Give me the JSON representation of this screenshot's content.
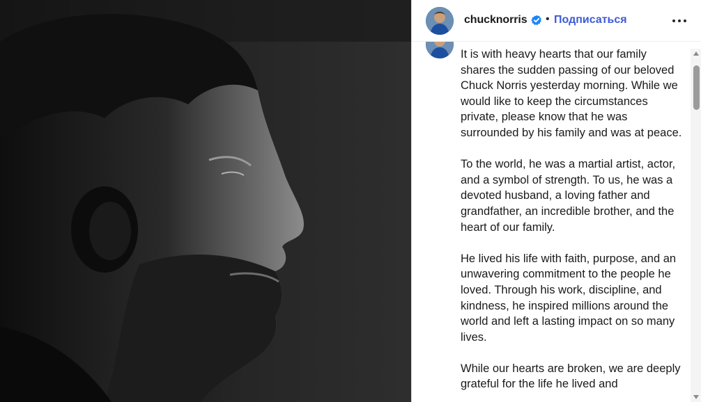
{
  "post": {
    "photo_description_icon": "profile-portrait-photo"
  },
  "header": {
    "username": "chucknorris",
    "separator": "•",
    "follow_label": "Подписаться",
    "verified_color": "#1b86f5",
    "accent_color": "#3d5bd6"
  },
  "caption": {
    "paragraphs": [
      "It is with heavy hearts that our family shares the sudden passing of our beloved Chuck Norris yesterday morning. While we would like to keep the circumstances private, please know that he was surrounded by his family and was at peace.",
      "To the world, he was a martial artist, actor, and a symbol of strength. To us, he was a devoted husband, a loving father and grandfather, an incredible brother, and the heart of our family.",
      "He lived his life with faith, purpose, and an unwavering commitment to the people he loved. Through his work, discipline, and kindness, he inspired millions around the world and left a lasting impact on so many lives.",
      "While our hearts are broken, we are deeply grateful for the life he lived and"
    ]
  }
}
